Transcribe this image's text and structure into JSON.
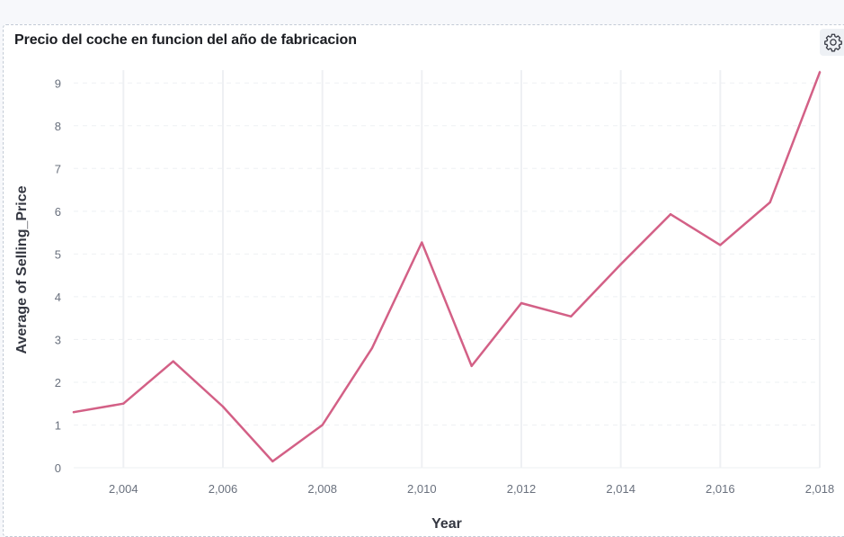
{
  "panel": {
    "title": "Precio del coche en funcion del año de fabricacion",
    "settings_icon": "gear-icon"
  },
  "colors": {
    "line": "#d36086",
    "grid": "#eef0f3",
    "tick_text": "#69707d",
    "title_text": "#1a1c21"
  },
  "chart_data": {
    "type": "line",
    "title": "Precio del coche en funcion del año de fabricacion",
    "xlabel": "Year",
    "ylabel": "Average of Selling_Price",
    "xlim": [
      2003,
      2018
    ],
    "ylim": [
      0,
      9.3
    ],
    "x_ticks": [
      "2,004",
      "2,006",
      "2,008",
      "2,010",
      "2,012",
      "2,014",
      "2,016",
      "2,018"
    ],
    "x_tick_values": [
      2004,
      2006,
      2008,
      2010,
      2012,
      2014,
      2016,
      2018
    ],
    "y_ticks": [
      "0",
      "1",
      "2",
      "3",
      "4",
      "5",
      "6",
      "7",
      "8",
      "9"
    ],
    "y_tick_values": [
      0,
      1,
      2,
      3,
      4,
      5,
      6,
      7,
      8,
      9
    ],
    "grid": true,
    "series": [
      {
        "x": [
          2003,
          2004,
          2005,
          2006,
          2007,
          2008,
          2009,
          2010,
          2011,
          2012,
          2013,
          2014,
          2015,
          2016,
          2017,
          2018
        ],
        "values": [
          1.3,
          1.5,
          2.49,
          1.43,
          0.15,
          1.0,
          2.8,
          5.27,
          2.38,
          3.85,
          3.54,
          4.76,
          5.93,
          5.21,
          6.21,
          9.25
        ]
      }
    ]
  }
}
